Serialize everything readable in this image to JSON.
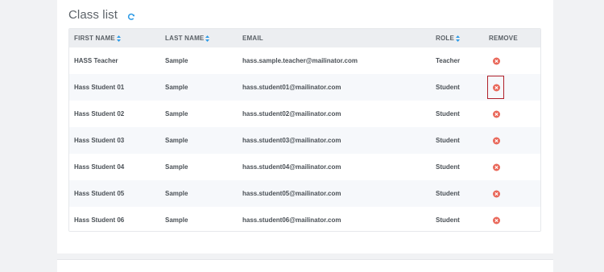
{
  "title": "Class list",
  "columns": {
    "first_name": "FIRST NAME",
    "last_name": "LAST NAME",
    "email": "EMAIL",
    "role": "ROLE",
    "remove": "REMOVE"
  },
  "rows": [
    {
      "first_name": "HASS Teacher",
      "last_name": "Sample",
      "email": "hass.sample.teacher@mailinator.com",
      "role": "Teacher"
    },
    {
      "first_name": "Hass Student 01",
      "last_name": "Sample",
      "email": "hass.student01@mailinator.com",
      "role": "Student"
    },
    {
      "first_name": "Hass Student 02",
      "last_name": "Sample",
      "email": "hass.student02@mailinator.com",
      "role": "Student"
    },
    {
      "first_name": "Hass Student 03",
      "last_name": "Sample",
      "email": "hass.student03@mailinator.com",
      "role": "Student"
    },
    {
      "first_name": "Hass Student 04",
      "last_name": "Sample",
      "email": "hass.student04@mailinator.com",
      "role": "Student"
    },
    {
      "first_name": "Hass Student 05",
      "last_name": "Sample",
      "email": "hass.student05@mailinator.com",
      "role": "Student"
    },
    {
      "first_name": "Hass Student 06",
      "last_name": "Sample",
      "email": "hass.student06@mailinator.com",
      "role": "Student"
    }
  ],
  "icons": {
    "refresh": "refresh-icon",
    "sort": "sort-icon",
    "remove": "remove-circle-x-icon"
  },
  "colors": {
    "accent": "#2e9be6",
    "remove": "#e9685a",
    "highlight": "#b0202a",
    "header_bg": "#eceef1"
  }
}
